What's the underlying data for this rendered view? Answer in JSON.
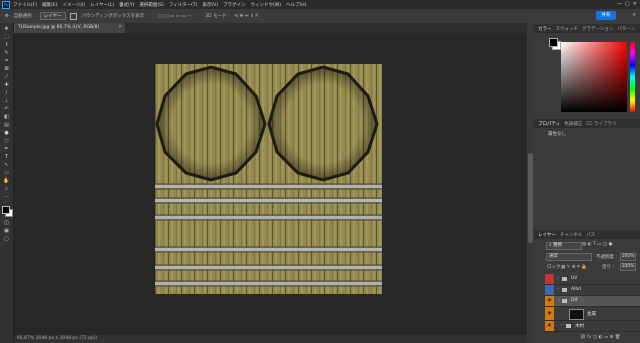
{
  "app": {
    "logo": "Ps"
  },
  "menu": [
    "ファイル(F)",
    "編集(E)",
    "イメージ(I)",
    "レイヤー(L)",
    "書式(Y)",
    "選択範囲(S)",
    "フィルター(T)",
    "表示(V)",
    "プラグイン",
    "ウィンドウ(W)",
    "ヘルプ(H)"
  ],
  "options": {
    "auto_select": "自動選択 :",
    "auto_select_value": "レイヤー",
    "transform_label": "バウンディングボックスを表示",
    "mode3d": "3D モード :",
    "share": "共有"
  },
  "document": {
    "tab": "TUSample.jpg @ 66.7% (UV, RGB/8)",
    "status": "66.67%    2048 px x 2048 px (72 ppi)"
  },
  "tools": [
    "move-tool",
    "artboard-tool",
    "marquee-tool",
    "lasso-tool",
    "quick-select-tool",
    "crop-tool",
    "frame-tool",
    "eyedropper-tool",
    "healing-tool",
    "brush-tool",
    "stamp-tool",
    "history-brush-tool",
    "eraser-tool",
    "gradient-tool",
    "blur-tool",
    "dodge-tool",
    "pen-tool",
    "type-tool",
    "path-select-tool",
    "shape-tool",
    "hand-tool",
    "zoom-tool",
    "more-tool"
  ],
  "color_panel": {
    "tabs": [
      "カラー",
      "スウォッチ",
      "グラデーション",
      "パターン"
    ],
    "fg": "#000000",
    "bg": "#ffffff"
  },
  "properties_panel": {
    "tabs": [
      "プロパティ",
      "色調補正",
      "CC ライブラリ"
    ],
    "empty_text": "属性なし"
  },
  "layers_panel": {
    "tabs": [
      "レイヤー",
      "チャンネル",
      "パス"
    ],
    "filter": "種類",
    "blend_mode": "通常",
    "opacity_label": "不透明度 :",
    "opacity": "100%",
    "lock_label": "ロック :",
    "fill_label": "塗り :",
    "fill": "100%",
    "layers": [
      {
        "name": "UV",
        "color": "#c03434",
        "visible": false
      },
      {
        "name": "Albd",
        "color": "#3b6ab5",
        "visible": false
      },
      {
        "name": "DIF",
        "color": "#d47a10",
        "visible": true,
        "selected": true
      },
      {
        "name": "金属",
        "color": "#d47a10",
        "visible": true,
        "thumb": true
      },
      {
        "name": "木材",
        "color": "#d47a10",
        "visible": true
      }
    ]
  }
}
